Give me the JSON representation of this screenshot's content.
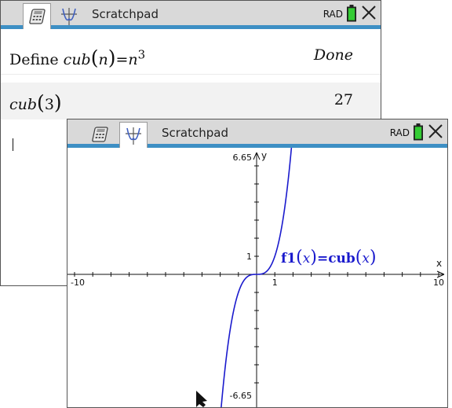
{
  "back_window": {
    "title": "Scratchpad",
    "mode": "RAD",
    "history": [
      {
        "expr_prefix": "Define ",
        "expr_func": "cub",
        "expr_arg": "n",
        "expr_eq": "=",
        "expr_base": "n",
        "expr_exp": "3",
        "result": "Done"
      },
      {
        "expr_func": "cub",
        "expr_arg": "3",
        "result": "27"
      }
    ]
  },
  "front_window": {
    "title": "Scratchpad",
    "mode": "RAD"
  },
  "graph": {
    "x_min_label": "-10",
    "x_max_label": "10",
    "y_max_label": "6.65",
    "y_min_label": "-6.65",
    "x_tick_label": "1",
    "y_tick_label": "1",
    "x_axis_name": "x",
    "y_axis_name": "y",
    "func_name": "f1",
    "func_var": "x",
    "func_eq": "=",
    "func_body": "cub",
    "func_arg": "x",
    "curve_color": "#1a1acd"
  },
  "chart_data": {
    "type": "line",
    "title": "",
    "xlim": [
      -10,
      10
    ],
    "ylim": [
      -6.65,
      6.65
    ],
    "xlabel": "x",
    "ylabel": "y",
    "series": [
      {
        "name": "f1(x)=cub(x)",
        "function": "x^3",
        "x": [
          -1.88,
          -1.5,
          -1.25,
          -1,
          -0.5,
          0,
          0.5,
          1,
          1.25,
          1.5,
          1.88
        ],
        "y": [
          -6.65,
          -3.375,
          -1.953,
          -1,
          -0.125,
          0,
          0.125,
          1,
          1.953,
          3.375,
          6.65
        ]
      }
    ],
    "grid": false
  }
}
